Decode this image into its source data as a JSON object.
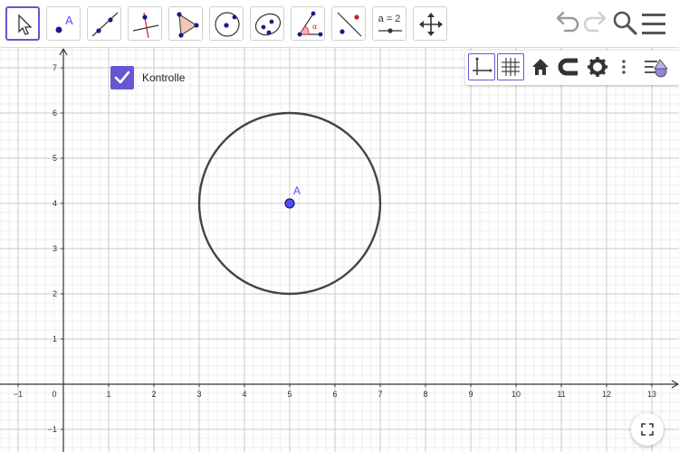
{
  "toolbar": {
    "tools": [
      {
        "id": "move",
        "icon": "arrow-pointer-icon",
        "selected": true
      },
      {
        "id": "point",
        "icon": "point-tool-icon",
        "label": "A"
      },
      {
        "id": "line",
        "icon": "line-tool-icon"
      },
      {
        "id": "perpendicular",
        "icon": "perpendicular-tool-icon"
      },
      {
        "id": "polygon",
        "icon": "polygon-tool-icon"
      },
      {
        "id": "circle-center",
        "icon": "circle-center-tool-icon"
      },
      {
        "id": "ellipse",
        "icon": "ellipse-tool-icon"
      },
      {
        "id": "angle",
        "icon": "angle-tool-icon",
        "label": "α"
      },
      {
        "id": "reflect",
        "icon": "reflect-tool-icon"
      },
      {
        "id": "slider",
        "icon": "slider-tool-icon",
        "label": "a = 2"
      },
      {
        "id": "move-view",
        "icon": "move-graphics-icon"
      }
    ],
    "right": [
      "undo-icon",
      "redo-icon",
      "search-icon",
      "menu-icon"
    ]
  },
  "style_bar": [
    "axes-toggle-icon",
    "grid-toggle-icon",
    "home-icon",
    "magnet-icon",
    "gear-icon",
    "more-vertical-icon",
    "style-bar-toggle-icon"
  ],
  "checkbox": {
    "label": "Kontrolle",
    "checked": true,
    "color": "#6557d2"
  },
  "graphics": {
    "x_ticks": [
      "−1",
      "0",
      "1",
      "2",
      "3",
      "4",
      "5",
      "6",
      "7",
      "8",
      "9",
      "10",
      "11",
      "12",
      "13"
    ],
    "y_ticks": [
      "−1",
      "1",
      "2",
      "3",
      "4",
      "5",
      "6",
      "7"
    ],
    "x_range": [
      -1.4,
      13.6
    ],
    "y_range": [
      -1.5,
      7.44
    ],
    "point": {
      "name": "A",
      "x": 5,
      "y": 4,
      "color": "#4d4dff"
    },
    "circle": {
      "center": "A",
      "radius": 2,
      "color": "#444444"
    }
  },
  "colors": {
    "accent": "#6557d2",
    "grid_minor": "#ececec",
    "grid_major": "#c8c8c8"
  }
}
